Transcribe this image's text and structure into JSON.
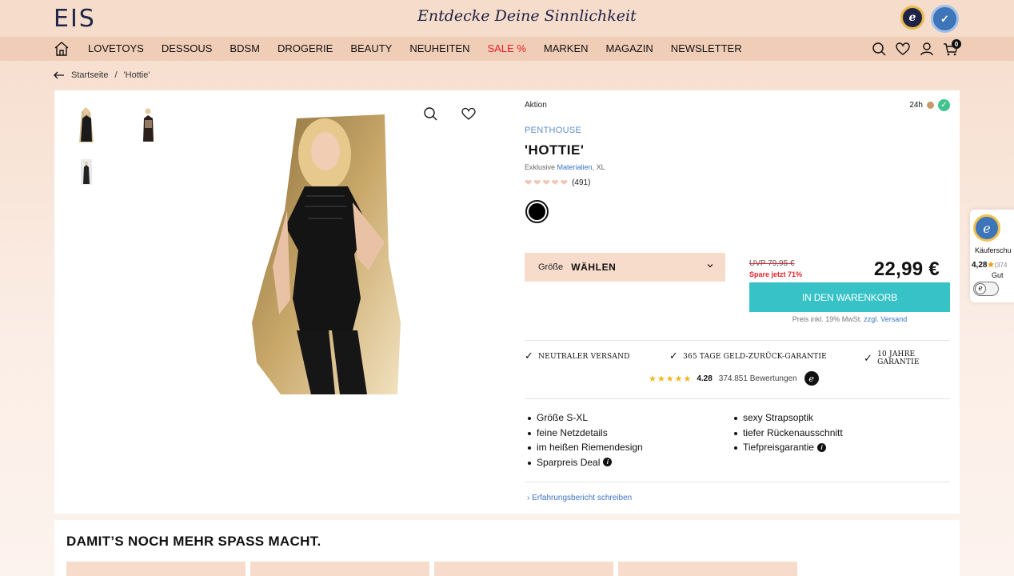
{
  "header": {
    "logo": "EIS",
    "tagline": "Entdecke Deine Sinnlichkeit"
  },
  "nav": {
    "items": [
      "LOVETOYS",
      "DESSOUS",
      "BDSM",
      "DROGERIE",
      "BEAUTY",
      "NEUHEITEN",
      "SALE %",
      "MARKEN",
      "MAGAZIN",
      "NEWSLETTER"
    ],
    "cart_count": "0"
  },
  "breadcrumb": {
    "home": "Startseite",
    "separator": "/",
    "current": "'Hottie'"
  },
  "product": {
    "aktion": "Aktion",
    "delivery": "24h",
    "brand": "PENTHOUSE",
    "title": "'HOTTIE'",
    "meta_prefix": "Exklusive",
    "meta_link": "Materialien",
    "meta_suffix": ", XL",
    "rating_count": "(491)",
    "rating_hearts": 5,
    "color": "#000000",
    "size_label": "Größe",
    "size_value": "WÄHLEN",
    "uvp": "UVP 79,95 €",
    "spare": "Spare jetzt 71%",
    "price": "22,99 €",
    "cart_button": "IN DEN WARENKORB",
    "price_note_prefix": "Preis inkl. 19% MwSt.",
    "price_note_link": "zzgl. Versand"
  },
  "usps": [
    "NEUTRALER VERSAND",
    "365 TAGE GELD-ZURÜCK-GARANTIE",
    "10 JAHRE GARANTIE"
  ],
  "trust": {
    "score": "4.28",
    "reviews": "374.851 Bewertungen",
    "stars": 4.28
  },
  "features_left": [
    "Größe S-XL",
    "feine Netzdetails",
    "im heißen Riemendesign",
    "Sparpreis Deal"
  ],
  "features_right": [
    "sexy Strapsoptik",
    "tiefer Rückenausschnitt",
    "Tiefpreisgarantie"
  ],
  "review_link": "Erfahrungsbericht schreiben",
  "trusted_shops": {
    "label": "Käuferschu",
    "score": "4,28",
    "count": "(374",
    "grade": "Gut"
  },
  "more_section": {
    "title": "DAMIT’S NOCH MEHR SPASS MACHT."
  }
}
